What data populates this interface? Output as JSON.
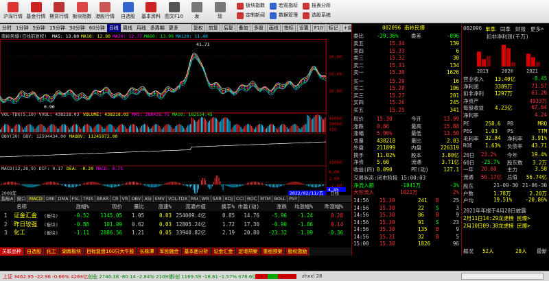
{
  "toolbar": {
    "buttons": [
      {
        "label": "沪深行情",
        "color": "#d33"
      },
      {
        "label": "基金行情",
        "color": "#c22"
      },
      {
        "label": "期货行情",
        "color": "#b33"
      },
      {
        "label": "板块指数",
        "color": "#d44"
      },
      {
        "label": "港股行情",
        "color": "#c55"
      },
      {
        "label": "自选股",
        "color": "#36c"
      },
      {
        "label": "基本资料",
        "color": "#c22"
      },
      {
        "label": "图文F10",
        "color": "#555"
      },
      {
        "label": "发",
        "color": "#777"
      },
      {
        "label": "现",
        "color": "#777"
      }
    ],
    "right": [
      {
        "label": "板块指数",
        "color": "#c33"
      },
      {
        "label": "宏观指标",
        "color": "#36c"
      },
      {
        "label": "报表分析",
        "color": "#c33"
      },
      {
        "label": "定制新闻",
        "color": "#c33"
      },
      {
        "label": "数据管理",
        "color": "#36c"
      },
      {
        "label": "选股系统",
        "color": "#c33"
      }
    ]
  },
  "menubar": {
    "items": [
      "分时",
      "1分钟",
      "5分钟",
      "15分钟",
      "30分钟",
      "60分钟",
      "日线",
      "周线",
      "月线",
      "多周期",
      "更多"
    ],
    "selected": 6,
    "right": [
      "复权",
      "前复",
      "后复",
      "叠加",
      "多股",
      "画线",
      "指标",
      "设置",
      "F10",
      "标记",
      "+自选"
    ]
  },
  "chart": {
    "header": "南岭民爆(日线前复权)",
    "ma": [
      {
        "label": "MA5: 13.80",
        "color": "#fff"
      },
      {
        "label": "MA10: 12.80",
        "color": "#ff0"
      },
      {
        "label": "MA20: 12.77",
        "color": "#f0f"
      },
      {
        "label": "MA60: 13.99",
        "color": "#0f0"
      },
      {
        "label": "MA120: 11.48",
        "color": "#0cf"
      }
    ],
    "high": "41.71",
    "low": "0.90",
    "yticks": [
      "30.00",
      "20.00",
      "10.00"
    ],
    "vol_header": [
      {
        "label": "VOL-TDX(5,10) VVOL: 438218.03",
        "color": "#ccc"
      },
      {
        "label": "VOLUME: 438218.03",
        "color": "#ff0"
      },
      {
        "label": "MA5: 288428.75",
        "color": "#f0f"
      },
      {
        "label": "MA10: 182534.45",
        "color": "#0f0"
      }
    ],
    "vol_ticks": [
      "40000",
      "20000",
      "X10"
    ],
    "obv_header": [
      {
        "label": "OBV(30) OBV: 12594434.00",
        "color": "#ccc"
      },
      {
        "label": "MAOBV: 11245972.00",
        "color": "#ff0"
      }
    ],
    "obv_tick": "X1000",
    "macd_header": [
      {
        "label": "MACD(12,26,9) DIF: 0.17",
        "color": "#ccc"
      },
      {
        "label": "DEA: -0.20",
        "color": "#ff0"
      },
      {
        "label": "MACD: 0.75",
        "color": "#f0f"
      }
    ],
    "macd_ticks": [
      "6.00",
      "2.00",
      "-2.00"
    ],
    "last_price": "4.85",
    "date_start": "2008年",
    "date_end": "2022/02/11/五",
    "period": "日线"
  },
  "panel_tabs": [
    "指标A",
    "窗口",
    "MACD",
    "DMI",
    "DMA",
    "FSL",
    "TRIX",
    "BRAR",
    "CR",
    "VR",
    "OBV",
    "ASI",
    "EMV",
    "VOL-TDX",
    "RSI",
    "WR",
    "SAR",
    "KDJ",
    "CCI",
    "ROC",
    "MTM",
    "BOLL",
    "PSY"
  ],
  "table": {
    "headers": [
      "名称",
      "涨幅%",
      "现价",
      "量比",
      "涨速%",
      "流通市值",
      "换手%",
      "市盈(动)",
      "涨跌",
      "均涨幅%",
      "昨涨幅%"
    ],
    "rows": [
      {
        "no": "1",
        "name": "证金汇金",
        "tag": "(板块)",
        "cells": [
          "-0.52",
          "1145.05",
          "1.05",
          "0.03",
          "254009.4亿",
          "0.85",
          "14.76",
          "-5.96",
          "-1.24",
          "0.28"
        ]
      },
      {
        "no": "2",
        "name": "昨日较强",
        "tag": "(板块)",
        "cells": [
          "-0.88",
          "101.09",
          "0.62",
          "0.03",
          "12805.24亿",
          "1.72",
          "17.30",
          "-0.90",
          "-1.86",
          "0.14"
        ]
      },
      {
        "no": "3",
        "name": "化工",
        "tag": "(板块)",
        "cells": [
          "-1.11",
          "2886.56",
          "1.21",
          "0.05",
          "33940.82亿",
          "2.19",
          "20.80",
          "-23.32",
          "-1.89",
          "-0.36"
        ]
      }
    ]
  },
  "sectors": [
    "关联品种",
    "自选股",
    "化工",
    "湖南板块",
    "目标复盘100只大牛股",
    "长株潭",
    "军民融合",
    "基本面分析",
    "证金汇金",
    "定增预案",
    "重组预案",
    "股权激励"
  ],
  "quote": {
    "code": "002096",
    "name": "南岭民爆",
    "weibi_label": "委比",
    "weibi": "-29.36%",
    "weicha_label": "委差",
    "weicha": "-896",
    "asks": [
      {
        "l": "卖五",
        "p": "15.34",
        "v": "139"
      },
      {
        "l": "卖四",
        "p": "15.33",
        "v": "6"
      },
      {
        "l": "卖三",
        "p": "15.32",
        "v": "30"
      },
      {
        "l": "卖二",
        "p": "15.31",
        "v": "134"
      },
      {
        "l": "卖一",
        "p": "15.30",
        "v": "1626"
      }
    ],
    "bids": [
      {
        "l": "买一",
        "p": "15.29",
        "v": "16"
      },
      {
        "l": "买二",
        "p": "15.28",
        "v": "106"
      },
      {
        "l": "买三",
        "p": "15.27",
        "v": "201"
      },
      {
        "l": "买四",
        "p": "15.26",
        "v": "245"
      },
      {
        "l": "买五",
        "p": "15.25",
        "v": "341"
      }
    ],
    "stats": [
      {
        "a": "现价",
        "av": "15.30",
        "b": "今开",
        "bv": "13.99"
      },
      {
        "a": "涨跌",
        "av": "0.86",
        "b": "最高",
        "bv": "15.88"
      },
      {
        "a": "涨幅",
        "av": "5.96%",
        "b": "最低",
        "bv": "13.50"
      },
      {
        "a": "总量",
        "av": "438218",
        "b": "量比",
        "bv": "2.03"
      },
      {
        "a": "外盘",
        "av": "211899",
        "b": "内盘",
        "bv": "226319"
      },
      {
        "a": "换手",
        "av": "11.02%",
        "b": "股本",
        "bv": "3.80亿"
      },
      {
        "a": "净资",
        "av": "5.60",
        "b": "流通",
        "bv": "3.71亿"
      },
      {
        "a": "收益(四)",
        "av": "0.090",
        "b": "PE(动)",
        "bv": "127.1"
      }
    ],
    "trade_status": "交易状态:闭市阶段 15:00:03",
    "net_label": "净流入额",
    "net": "-1841万",
    "net_pct": "-3%",
    "big_label": "大宗流入",
    "big": "1021万",
    "big_pct": "2%",
    "ticks": [
      {
        "t": "14:56",
        "p": "15.30",
        "v": "241",
        "f": "B",
        "n": "25"
      },
      {
        "t": "14:56",
        "p": "15.30",
        "v": "22",
        "f": "S",
        "n": "3"
      },
      {
        "t": "14:56",
        "p": "15.30",
        "v": "86",
        "f": "B",
        "n": "9"
      },
      {
        "t": "14:56",
        "p": "15.30",
        "v": "91",
        "f": "S",
        "n": "23"
      },
      {
        "t": "14:56",
        "p": "15.30",
        "v": "135",
        "f": "B",
        "n": "9"
      },
      {
        "t": "14:56",
        "p": "15.31",
        "v": "32",
        "f": "B",
        "n": "5"
      },
      {
        "t": "15:00",
        "p": "15.30",
        "v": "1826",
        "f": "",
        "n": "96"
      }
    ]
  },
  "right": {
    "code": "002096",
    "tabs": [
      "单季",
      "同季",
      "财报",
      "更多>"
    ],
    "chart_title": "扣非净利润(千万)",
    "chart_data": {
      "type": "bar",
      "categories": [
        "2019",
        "2020",
        "2021"
      ],
      "series": [
        {
          "values": [
            6.5,
            9.5,
            5.6
          ],
          "color": "#d00"
        },
        {
          "values": [
            3.2,
            8.0,
            4.1
          ],
          "color": "#c00"
        },
        {
          "values": [
            4.5,
            1.8,
            2.0
          ],
          "color": "#700"
        }
      ],
      "ylim": [
        0,
        12
      ]
    },
    "fin": [
      {
        "l": "营业收入",
        "v": "13.40亿",
        "c": "-8.45"
      },
      {
        "l": "净利润",
        "v": "3389万",
        "c": "71.57"
      },
      {
        "l": "扣非净利",
        "v": "1297万",
        "c": "61.26"
      },
      {
        "l": "净资产",
        "v": "",
        "c": "4933万"
      },
      {
        "l": "每股收益",
        "v": "4.23亿",
        "c": "67.64"
      },
      {
        "l": "净利率",
        "v": "",
        "c": "4.24"
      }
    ],
    "valuation": [
      {
        "l": "PE",
        "v": "258.6",
        "r": "PB",
        "rv": "MRQ"
      },
      {
        "l": "PEG",
        "v": "1.03",
        "r": "PS",
        "rv": "TTM"
      },
      {
        "l": "毛利率",
        "v": "32.84",
        "r": "净利率",
        "rv": "3.91%"
      },
      {
        "l": "ROE",
        "v": "1.63%",
        "r": "负债率",
        "rv": "43.71"
      }
    ],
    "perf": [
      {
        "l": "20日",
        "v": "23.2%",
        "r": "今年",
        "rv": "19.4%"
      },
      {
        "l": "60日",
        "v": "-25.7%",
        "r": "股东数",
        "rv": "3.2万"
      },
      {
        "l": "一年",
        "v": "20.60",
        "r": "主力",
        "rv": "3.58"
      },
      {
        "l": "流通",
        "v": "56.17亿",
        "r": "总值",
        "rv": "56.74亿"
      }
    ],
    "holders_header": [
      "股东",
      "21-09-30",
      "21-06-30"
    ],
    "holders": [
      {
        "l": "户数",
        "a": "1.78万",
        "b": "2.20万"
      },
      {
        "l": "户均",
        "a": "19.51%",
        "b": "-20.86%"
      }
    ],
    "news": [
      "2021年年报于4月28日披露",
      "2月11日14:29龙虎榜 民爆>",
      "2月10日09:38龙虎榜 民爆>"
    ],
    "footer_left": "概况",
    "footer_count": "52人",
    "footer_right": "20人",
    "footer_label": "最新"
  },
  "status": {
    "idx1": "上证 3462.95 -22.96 -0.66% 4263亿",
    "idx2": "创业 2746.38 -80.14 -2.84% 2109亿",
    "idx3": "科创 1169.59 -18.61 -1.57% 378.6亿",
    "right": "zhxxl 28"
  }
}
